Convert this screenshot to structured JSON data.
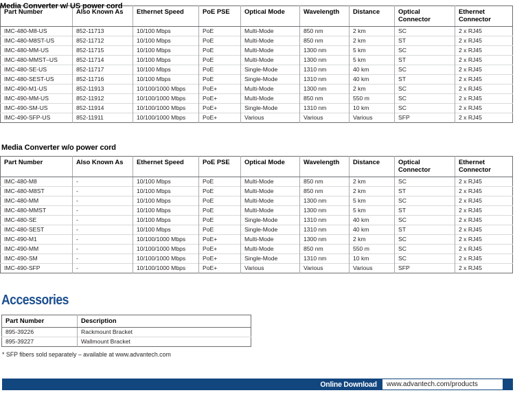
{
  "document": {
    "section_us_title": "Media Converter w/ US power cord",
    "section_nocord_title": "Media Converter w/o power cord",
    "accessories_title": "Accessories",
    "footnote": "* SFP fibers sold separately – available at www.advantech.com"
  },
  "colors": {
    "accent_blue": "#1c4f8f",
    "footer_bar": "#12467f",
    "table_border": "#6d6e71",
    "row_line": "#d9dadb",
    "text": "#231f20"
  },
  "spec_columns": [
    "Part Number",
    "Also Known As",
    "Ethernet Speed",
    "PoE PSE",
    "Optical Mode",
    "Wavelength",
    "Distance",
    "Optical Connector",
    "Ethernet Connector"
  ],
  "table_us_rows": [
    [
      "IMC-480-M8-US",
      "852-11713",
      "10/100 Mbps",
      "PoE",
      "Multi-Mode",
      "850 nm",
      "2 km",
      "SC",
      "2 x RJ45"
    ],
    [
      "IMC-480-M8ST-US",
      "852-11712",
      "10/100 Mbps",
      "PoE",
      "Multi-Mode",
      "850 nm",
      "2 km",
      "ST",
      "2 x RJ45"
    ],
    [
      "IMC-480-MM-US",
      "852-11715",
      "10/100 Mbps",
      "PoE",
      "Multi-Mode",
      "1300 nm",
      "5 km",
      "SC",
      "2 x RJ45"
    ],
    [
      "IMC-480-MMST–US",
      "852-11714",
      "10/100 Mbps",
      "PoE",
      "Multi-Mode",
      "1300 nm",
      "5 km",
      "ST",
      "2 x RJ45"
    ],
    [
      "IMC-480-SE-US",
      "852-11717",
      "10/100 Mbps",
      "PoE",
      "Single-Mode",
      "1310 nm",
      "40 km",
      "SC",
      "2 x RJ45"
    ],
    [
      "IMC-480-SEST-US",
      "852-11716",
      "10/100 Mbps",
      "PoE",
      "Single-Mode",
      "1310 nm",
      "40 km",
      "ST",
      "2 x RJ45"
    ],
    [
      "IMC-490-M1-US",
      "852-11913",
      "10/100/1000 Mbps",
      "PoE+",
      "Multi-Mode",
      "1300 nm",
      "2 km",
      "SC",
      "2 x RJ45"
    ],
    [
      "IMC-490-MM-US",
      "852-11912",
      "10/100/1000 Mbps",
      "PoE+",
      "Multi-Mode",
      "850 nm",
      "550 m",
      "SC",
      "2 x RJ45"
    ],
    [
      "IMC-490-SM-US",
      "852-11914",
      "10/100/1000 Mbps",
      "PoE+",
      "Single-Mode",
      "1310 nm",
      "10 km",
      "SC",
      "2 x RJ45"
    ],
    [
      "IMC-490-SFP-US",
      "852-11911",
      "10/100/1000 Mbps",
      "PoE+",
      "Various",
      "Various",
      "Various",
      "SFP",
      "2 x RJ45"
    ]
  ],
  "table_nocord_rows": [
    [
      "IMC-480-M8",
      "-",
      "10/100 Mbps",
      "PoE",
      "Multi-Mode",
      "850 nm",
      "2 km",
      "SC",
      "2 x RJ45"
    ],
    [
      "IMC-480-M8ST",
      "-",
      "10/100 Mbps",
      "PoE",
      "Multi-Mode",
      "850 nm",
      "2 km",
      "ST",
      "2 x RJ45"
    ],
    [
      "IMC-480-MM",
      "-",
      "10/100 Mbps",
      "PoE",
      "Multi-Mode",
      "1300 nm",
      "5 km",
      "SC",
      "2 x RJ45"
    ],
    [
      "IMC-480-MMST",
      "-",
      "10/100 Mbps",
      "PoE",
      "Multi-Mode",
      "1300 nm",
      "5 km",
      "ST",
      "2 x RJ45"
    ],
    [
      "IMC-480-SE",
      "-",
      "10/100 Mbps",
      "PoE",
      "Single-Mode",
      "1310 nm",
      "40 km",
      "SC",
      "2 x RJ45"
    ],
    [
      "IMC-480-SEST",
      "-",
      "10/100 Mbps",
      "PoE",
      "Single-Mode",
      "1310 nm",
      "40 km",
      "ST",
      "2 x RJ45"
    ],
    [
      "IMC-490-M1",
      "-",
      "10/100/1000 Mbps",
      "PoE+",
      "Multi-Mode",
      "1300 nm",
      "2 km",
      "SC",
      "2 x RJ45"
    ],
    [
      "IMC-490-MM",
      "-",
      "10/100/1000 Mbps",
      "PoE+",
      "Multi-Mode",
      "850 nm",
      "550 m",
      "SC",
      "2 x RJ45"
    ],
    [
      "IMC-490-SM",
      "-",
      "10/100/1000 Mbps",
      "PoE+",
      "Single-Mode",
      "1310 nm",
      "10 km",
      "SC",
      "2 x RJ45"
    ],
    [
      "IMC-490-SFP",
      "-",
      "10/100/1000 Mbps",
      "PoE+",
      "Various",
      "Various",
      "Various",
      "SFP",
      "2 x RJ45"
    ]
  ],
  "accessories_columns": [
    "Part Number",
    "Description"
  ],
  "accessories_rows": [
    [
      "895-39226",
      "Rackmount Bracket"
    ],
    [
      "895-39227",
      "Wallmount Bracket"
    ]
  ],
  "footer": {
    "label": "Online Download",
    "url": "www.advantech.com/products"
  }
}
